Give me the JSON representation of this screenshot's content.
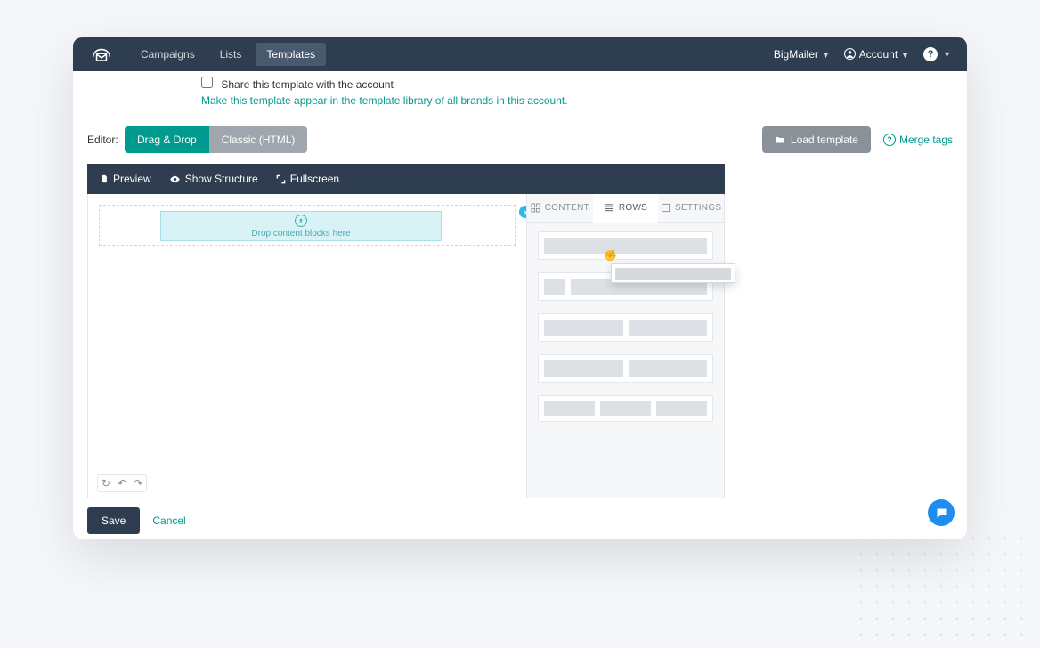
{
  "nav": {
    "items": [
      {
        "label": "Campaigns"
      },
      {
        "label": "Lists"
      },
      {
        "label": "Templates",
        "active": true
      }
    ],
    "brand": "BigMailer",
    "account": "Account"
  },
  "share": {
    "label": "Share this template with the account",
    "help": "Make this template appear in the template library of all brands in this account."
  },
  "editor": {
    "label": "Editor:",
    "dragdrop": "Drag & Drop",
    "classic": "Classic (HTML)",
    "load": "Load template",
    "merge": "Merge tags"
  },
  "builderBar": {
    "preview": "Preview",
    "structure": "Show Structure",
    "fullscreen": "Fullscreen"
  },
  "dropzone": "Drop content blocks here",
  "sideTabs": {
    "content": "CONTENT",
    "rows": "ROWS",
    "settings": "SETTINGS"
  },
  "footer": {
    "save": "Save",
    "cancel": "Cancel"
  }
}
